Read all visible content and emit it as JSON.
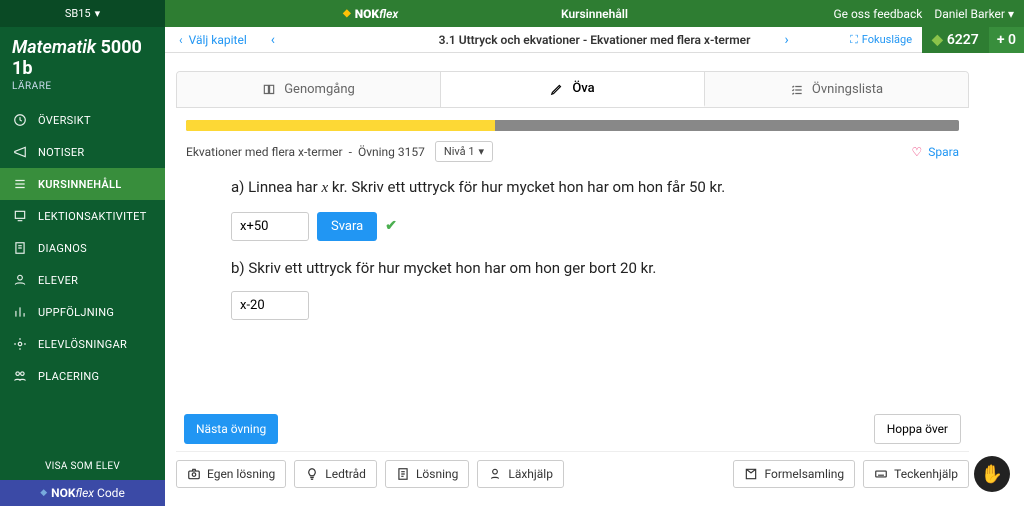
{
  "topbar": {
    "brand_nok": "NOK",
    "brand_flex": "flex",
    "title": "Kursinnehåll",
    "feedback": "Ge oss feedback",
    "user": "Daniel Barker"
  },
  "sidebar": {
    "course_sel": "SB15",
    "course_name_a": "Matematik",
    "course_name_b": "5000 1b",
    "role": "LÄRARE",
    "items": [
      {
        "label": "ÖVERSIKT",
        "icon": "dashboard-icon"
      },
      {
        "label": "NOTISER",
        "icon": "megaphone-icon"
      },
      {
        "label": "KURSINNEHÅLL",
        "icon": "list-icon",
        "active": true
      },
      {
        "label": "LEKTIONSAKTIVITET",
        "icon": "activity-icon"
      },
      {
        "label": "DIAGNOS",
        "icon": "diagnos-icon"
      },
      {
        "label": "ELEVER",
        "icon": "user-icon"
      },
      {
        "label": "UPPFÖLJNING",
        "icon": "bar-icon"
      },
      {
        "label": "ELEVLÖSNINGAR",
        "icon": "solutions-icon"
      },
      {
        "label": "PLACERING",
        "icon": "seat-icon"
      }
    ],
    "view_as": "VISA SOM ELEV",
    "footer_nok": "NOK",
    "footer_flex": "flex",
    "footer_code": " Code"
  },
  "chapter": {
    "back": "Välj kapitel",
    "title": "3.1 Uttryck och ekvationer - Ekvationer med flera x-termer",
    "focus": "Fokusläge",
    "points": "6227",
    "plus": "+ 0"
  },
  "tabs": {
    "genom": "Genomgång",
    "ova": "Öva",
    "ovlist": "Övningslista"
  },
  "exercise": {
    "bread1": "Ekvationer med flera x-termer",
    "sep": "-",
    "bread2": "Övning 3157",
    "level": "Nivå 1",
    "save": "Spara"
  },
  "q": {
    "a_pre": "a) Linnea har ",
    "a_var": "x",
    "a_post": " kr. Skriv ett uttryck för hur mycket hon har om hon får 50 kr.",
    "a_ans": "x+50",
    "a_btn": "Svara",
    "b_text": "b) Skriv ett uttryck för hur mycket hon har om hon ger bort 20 kr.",
    "b_ans": "x-20"
  },
  "footer": {
    "next": "Nästa övning",
    "skip": "Hoppa över",
    "own": "Egen lösning",
    "hint": "Ledtråd",
    "solution": "Lösning",
    "help": "Läxhjälp",
    "formulas": "Formelsamling",
    "chars": "Teckenhjälp"
  }
}
